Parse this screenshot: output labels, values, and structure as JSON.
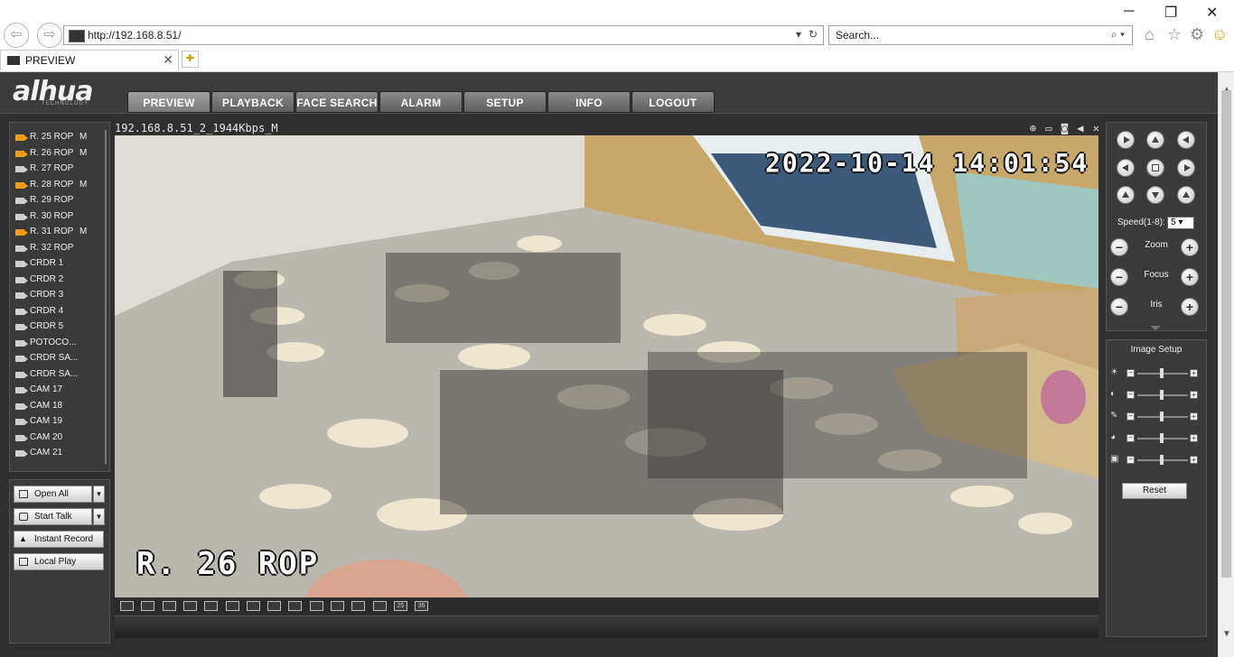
{
  "browser": {
    "url": "http://192.168.8.51/",
    "search_placeholder": "Search...",
    "tab_title": "PREVIEW"
  },
  "app": {
    "logo": "alhua",
    "logo_sub": "TECHNOLOGY",
    "nav": [
      "PREVIEW",
      "PLAYBACK",
      "FACE SEARCH",
      "ALARM",
      "SETUP",
      "INFO",
      "LOGOUT"
    ],
    "active_nav": "PREVIEW"
  },
  "channels": [
    {
      "label": "R. 25 ROP",
      "flag": "M",
      "recording": true
    },
    {
      "label": "R. 26 ROP",
      "flag": "M",
      "recording": true
    },
    {
      "label": "R. 27 ROP",
      "flag": "",
      "recording": false
    },
    {
      "label": "R. 28 ROP",
      "flag": "M",
      "recording": true
    },
    {
      "label": "R. 29 ROP",
      "flag": "",
      "recording": false
    },
    {
      "label": "R. 30 ROP",
      "flag": "",
      "recording": false
    },
    {
      "label": "R. 31 ROP",
      "flag": "M",
      "recording": true
    },
    {
      "label": "R. 32 ROP",
      "flag": "",
      "recording": false
    },
    {
      "label": "CRDR 1",
      "flag": "",
      "recording": false
    },
    {
      "label": "CRDR 2",
      "flag": "",
      "recording": false
    },
    {
      "label": "CRDR 3",
      "flag": "",
      "recording": false
    },
    {
      "label": "CRDR 4",
      "flag": "",
      "recording": false
    },
    {
      "label": "CRDR 5",
      "flag": "",
      "recording": false
    },
    {
      "label": "POTOCO...",
      "flag": "",
      "recording": false
    },
    {
      "label": "CRDR SA...",
      "flag": "",
      "recording": false
    },
    {
      "label": "CRDR SA...",
      "flag": "",
      "recording": false
    },
    {
      "label": "CAM 17",
      "flag": "",
      "recording": false
    },
    {
      "label": "CAM 18",
      "flag": "",
      "recording": false
    },
    {
      "label": "CAM 19",
      "flag": "",
      "recording": false
    },
    {
      "label": "CAM 20",
      "flag": "",
      "recording": false
    },
    {
      "label": "CAM 21",
      "flag": "",
      "recording": false
    }
  ],
  "left_buttons": {
    "open_all": "Open All",
    "start_talk": "Start Talk",
    "instant_record": "Instant Record",
    "local_play": "Local Play"
  },
  "video": {
    "stream_label": "192.168.8.51_2_1944Kbps_M",
    "timestamp": "2022-10-14 14:01:54",
    "camera_name": "R. 26 ROP"
  },
  "layouts": [
    "",
    "",
    "",
    "",
    "",
    "",
    "",
    "",
    "",
    "",
    "",
    "",
    "",
    "25",
    "36"
  ],
  "ptz": {
    "speed_label": "Speed(1-8):",
    "speed_value": "5",
    "zoom": "Zoom",
    "focus": "Focus",
    "iris": "Iris"
  },
  "image_setup": {
    "title": "Image Setup",
    "reset": "Reset"
  },
  "colors": {
    "record_active": "#f39a16",
    "panel_bg": "#3a3a3a",
    "page_bg": "#2f2f2f"
  }
}
